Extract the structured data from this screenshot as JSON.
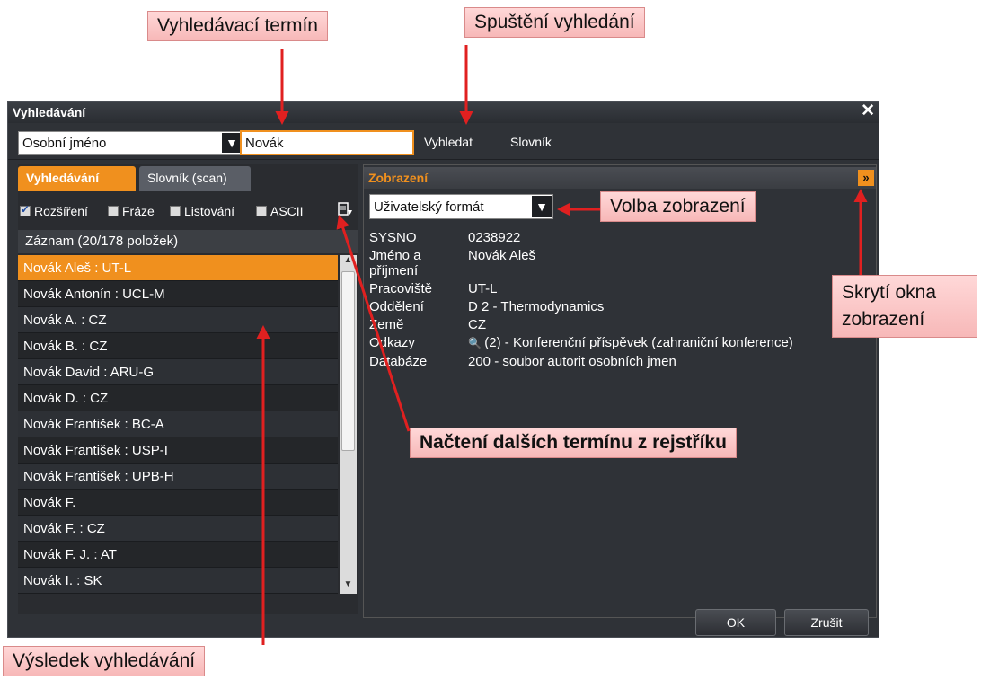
{
  "dialog": {
    "title": "Vyhledávání",
    "close_icon": "close-icon",
    "search_type": "Osobní jméno",
    "search_term": "Novák",
    "search_button": "Vyhledat",
    "dictionary_button": "Slovník"
  },
  "left": {
    "tabs": [
      "Vyhledávání",
      "Slovník (scan)"
    ],
    "options": [
      {
        "label": "Rozšíření",
        "checked": true
      },
      {
        "label": "Fráze",
        "checked": false
      },
      {
        "label": "Listování",
        "checked": false
      },
      {
        "label": "ASCII",
        "checked": false
      }
    ],
    "load_more_icon": "load-more-icon",
    "list_header": "Záznam (20/178 položek)",
    "rows": [
      "Novák Aleš : UT-L",
      "Novák Antonín : UCL-M",
      "Novák A. : CZ",
      "Novák B. : CZ",
      "Novák David : ARU-G",
      "Novák D. : CZ",
      "Novák František : BC-A",
      "Novák František : USP-I",
      "Novák František : UPB-H",
      "Novák F.",
      "Novák F. : CZ",
      "Novák F. J. : AT",
      "Novák I. : SK"
    ],
    "selected_index": 0
  },
  "right": {
    "title": "Zobrazení",
    "hide_icon": "double-chevron-right-icon",
    "format": "Uživatelský formát",
    "fields": [
      {
        "label": "SYSNO",
        "value": "0238922"
      },
      {
        "label": "Jméno a příjmení",
        "value": "Novák Aleš"
      },
      {
        "label": "Pracoviště",
        "value": "UT-L"
      },
      {
        "label": "Oddělení",
        "value": "D 2 - Thermodynamics"
      },
      {
        "label": "Země",
        "value": "CZ"
      },
      {
        "label": "Odkazy",
        "value": "(2) - Konferenční příspěvek (zahraniční konference)"
      },
      {
        "label": "Databáze",
        "value": "200 - soubor autorit osobních jmen"
      }
    ]
  },
  "footer": {
    "ok": "OK",
    "cancel": "Zrušit"
  },
  "callouts": {
    "search_term": "Vyhledávací termín",
    "run_search": "Spuštění vyhledání",
    "view_choice": "Volba zobrazení",
    "hide_view_1": "Skrytí okna",
    "hide_view_2": "zobrazení",
    "load_more": "Načtení dalších termínu z rejstříku",
    "result": "Výsledek vyhledávání"
  },
  "colors": {
    "accent": "#f0901e",
    "callout": "#f7b8b8",
    "arrow": "#e02020"
  }
}
